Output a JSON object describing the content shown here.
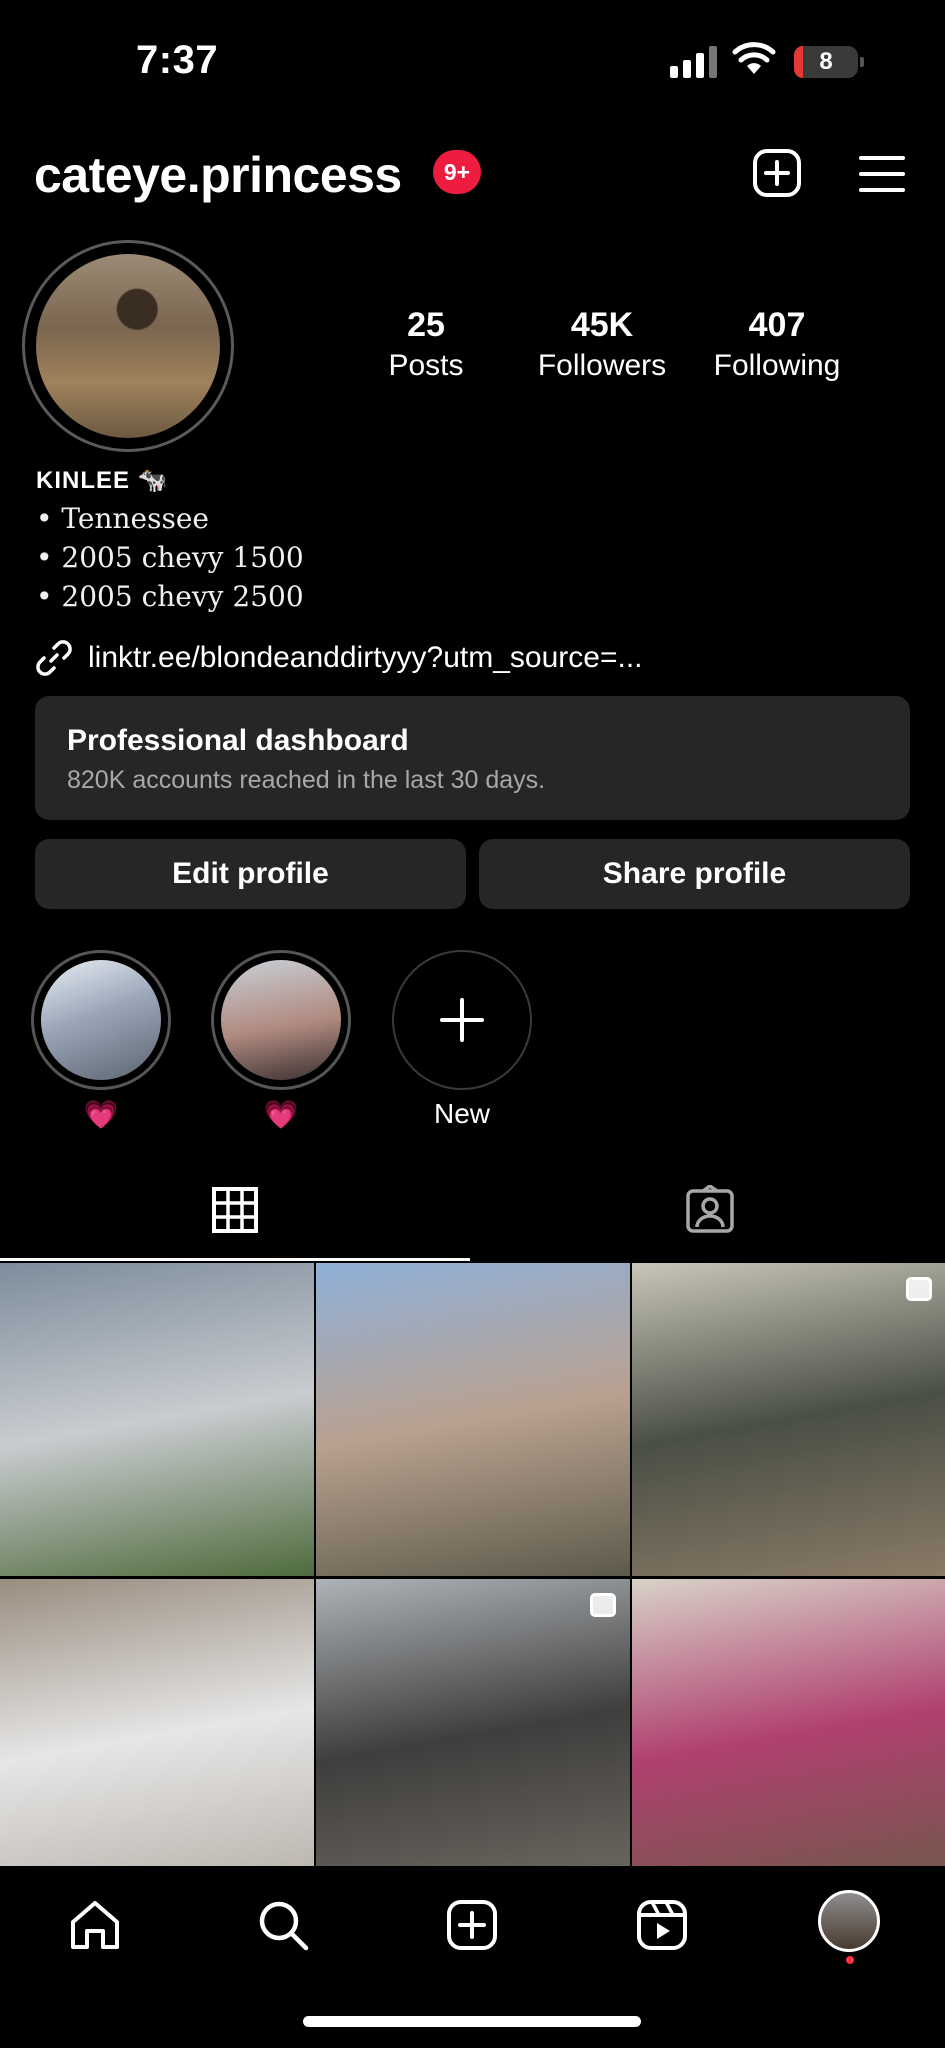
{
  "status_bar": {
    "time": "7:37",
    "battery": "8"
  },
  "header": {
    "username": "cateye.princess",
    "notification_badge": "9+"
  },
  "profile": {
    "stats": [
      {
        "value": "25",
        "label": "Posts"
      },
      {
        "value": "45K",
        "label": "Followers"
      },
      {
        "value": "407",
        "label": "Following"
      }
    ],
    "display_name": "KINLEE 🐄",
    "bio_lines": [
      "• Tennessee",
      "• 2005 chevy 1500",
      "• 2005 chevy 2500"
    ],
    "link": "linktr.ee/blondeanddirtyyy?utm_source=..."
  },
  "dashboard": {
    "title": "Professional dashboard",
    "subtitle": "820K accounts reached in the last 30 days."
  },
  "buttons": {
    "edit": "Edit profile",
    "share": "Share profile"
  },
  "highlights": [
    {
      "label": "💗",
      "color": "#9aa6b8"
    },
    {
      "label": "💗",
      "color": "#b08a80"
    }
  ],
  "new_highlight_label": "New",
  "tabs": [
    "grid-icon",
    "tagged-icon"
  ],
  "posts": [
    {
      "colors": [
        "#7d8d9c",
        "#c9ccd0",
        "#4f6b3d"
      ],
      "multi": false
    },
    {
      "colors": [
        "#8fb0d8",
        "#b9a190",
        "#5d5a4a"
      ],
      "multi": false
    },
    {
      "colors": [
        "#c8c6b8",
        "#4a4f45",
        "#8a7a66"
      ],
      "multi": true
    },
    {
      "colors": [
        "#9a8d7f",
        "#e6e6e6",
        "#b7b0a8"
      ],
      "multi": false
    },
    {
      "colors": [
        "#aeb3b8",
        "#3f3e3d",
        "#6f6a62"
      ],
      "multi": true
    },
    {
      "colors": [
        "#d8d2c8",
        "#b04070",
        "#6e5a48"
      ],
      "multi": false
    }
  ],
  "nav": [
    "home-icon",
    "search-icon",
    "create-icon",
    "reels-icon",
    "profile-avatar"
  ]
}
